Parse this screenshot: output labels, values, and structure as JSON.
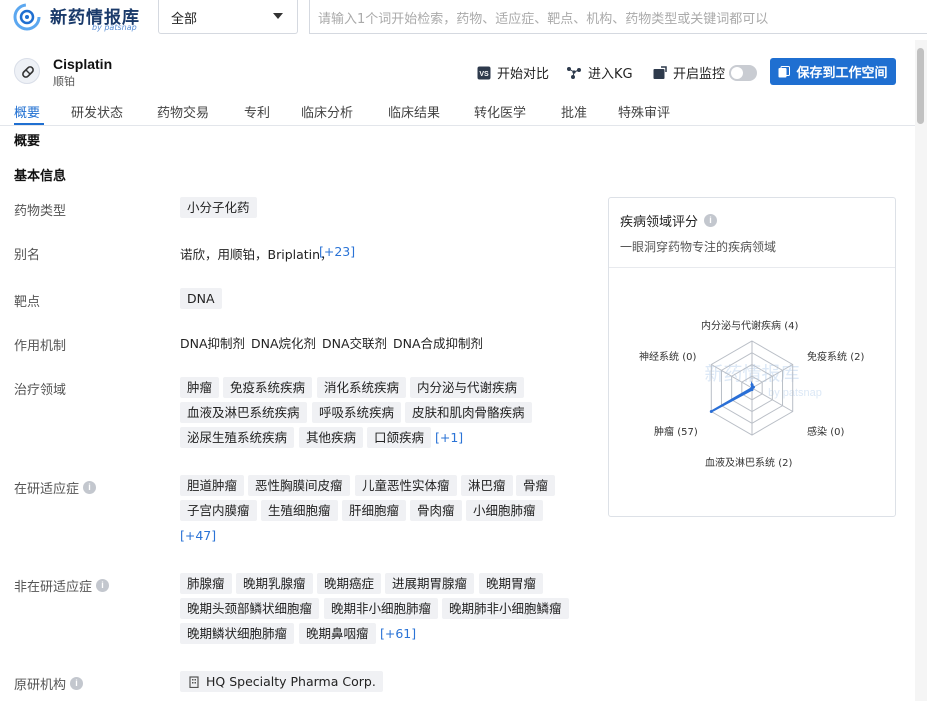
{
  "app": {
    "name": "新药情报库",
    "by": "by patsnap"
  },
  "search": {
    "scope": "全部",
    "placeholder": "请输入1个词开始检索，药物、适应症、靶点、机构、药物类型或关键词都可以"
  },
  "drug": {
    "name": "Cisplatin",
    "cn_name": "顺铂"
  },
  "actions": {
    "compare": "开始对比",
    "kg": "进入KG",
    "monitor": "开启监控",
    "monitor_on": false,
    "save": "保存到工作空间"
  },
  "tabs": [
    "概要",
    "研发状态",
    "药物交易",
    "专利",
    "临床分析",
    "临床结果",
    "转化医学",
    "批准",
    "特殊审评"
  ],
  "overview": {
    "section": "概要",
    "basic_info": "基本信息",
    "rows": {
      "drug_type": {
        "label": "药物类型",
        "values": [
          "小分子化药"
        ]
      },
      "alias": {
        "label": "别名",
        "text": "诺欣，用顺铂，Briplatin，",
        "more": "[+23]"
      },
      "target": {
        "label": "靶点",
        "values": [
          "DNA"
        ]
      },
      "mechanism": {
        "label": "作用机制",
        "values": [
          "DNA抑制剂",
          "DNA烷化剂",
          "DNA交联剂",
          "DNA合成抑制剂"
        ]
      },
      "therapeutic_area": {
        "label": "治疗领域",
        "values": [
          "肿瘤",
          "免疫系统疾病",
          "消化系统疾病",
          "内分泌与代谢疾病",
          "血液及淋巴系统疾病",
          "呼吸系统疾病",
          "皮肤和肌肉骨骼疾病",
          "泌尿生殖系统疾病",
          "其他疾病",
          "口颌疾病"
        ],
        "more": "[+1]"
      },
      "active_indications": {
        "label": "在研适应症",
        "values": [
          "胆道肿瘤",
          "恶性胸膜间皮瘤",
          "儿童恶性实体瘤",
          "淋巴瘤",
          "骨瘤",
          "子宫内膜瘤",
          "生殖细胞瘤",
          "肝细胞瘤",
          "骨肉瘤",
          "小细胞肺瘤"
        ],
        "more": "[+47]"
      },
      "inactive_indications": {
        "label": "非在研适应症",
        "values": [
          "肺腺瘤",
          "晚期乳腺瘤",
          "晚期癌症",
          "进展期胃腺瘤",
          "晚期胃瘤",
          "晚期头颈部鳞状细胞瘤",
          "晚期非小细胞肺瘤",
          "晚期肺非小细胞鳞瘤",
          "晚期鳞状细胞肺瘤",
          "晚期鼻咽瘤"
        ],
        "more": "[+61]"
      },
      "originator": {
        "label": "原研机构",
        "values": [
          "HQ Specialty Pharma Corp."
        ]
      }
    }
  },
  "radar": {
    "title": "疾病领域评分",
    "subtitle": "一眼洞穿药物专注的疾病领域",
    "watermark": "新药情报库 by patsnap",
    "axes": [
      {
        "name": "内分泌与代谢疾病",
        "count": "(4)",
        "value": 4
      },
      {
        "name": "免疫系统",
        "count": "(2)",
        "value": 2
      },
      {
        "name": "感染",
        "count": "(0)",
        "value": 0
      },
      {
        "name": "血液及淋巴系统",
        "count": "(2)",
        "value": 2
      },
      {
        "name": "肿瘤",
        "count": "(57)",
        "value": 57
      },
      {
        "name": "神经系统",
        "count": "(0)",
        "value": 0
      }
    ],
    "max": 57,
    "accent": "#2a6fd6"
  },
  "colors": {
    "accent": "#1f6fd1",
    "tag_bg": "#f0f1f4",
    "link": "#2a73d6"
  }
}
